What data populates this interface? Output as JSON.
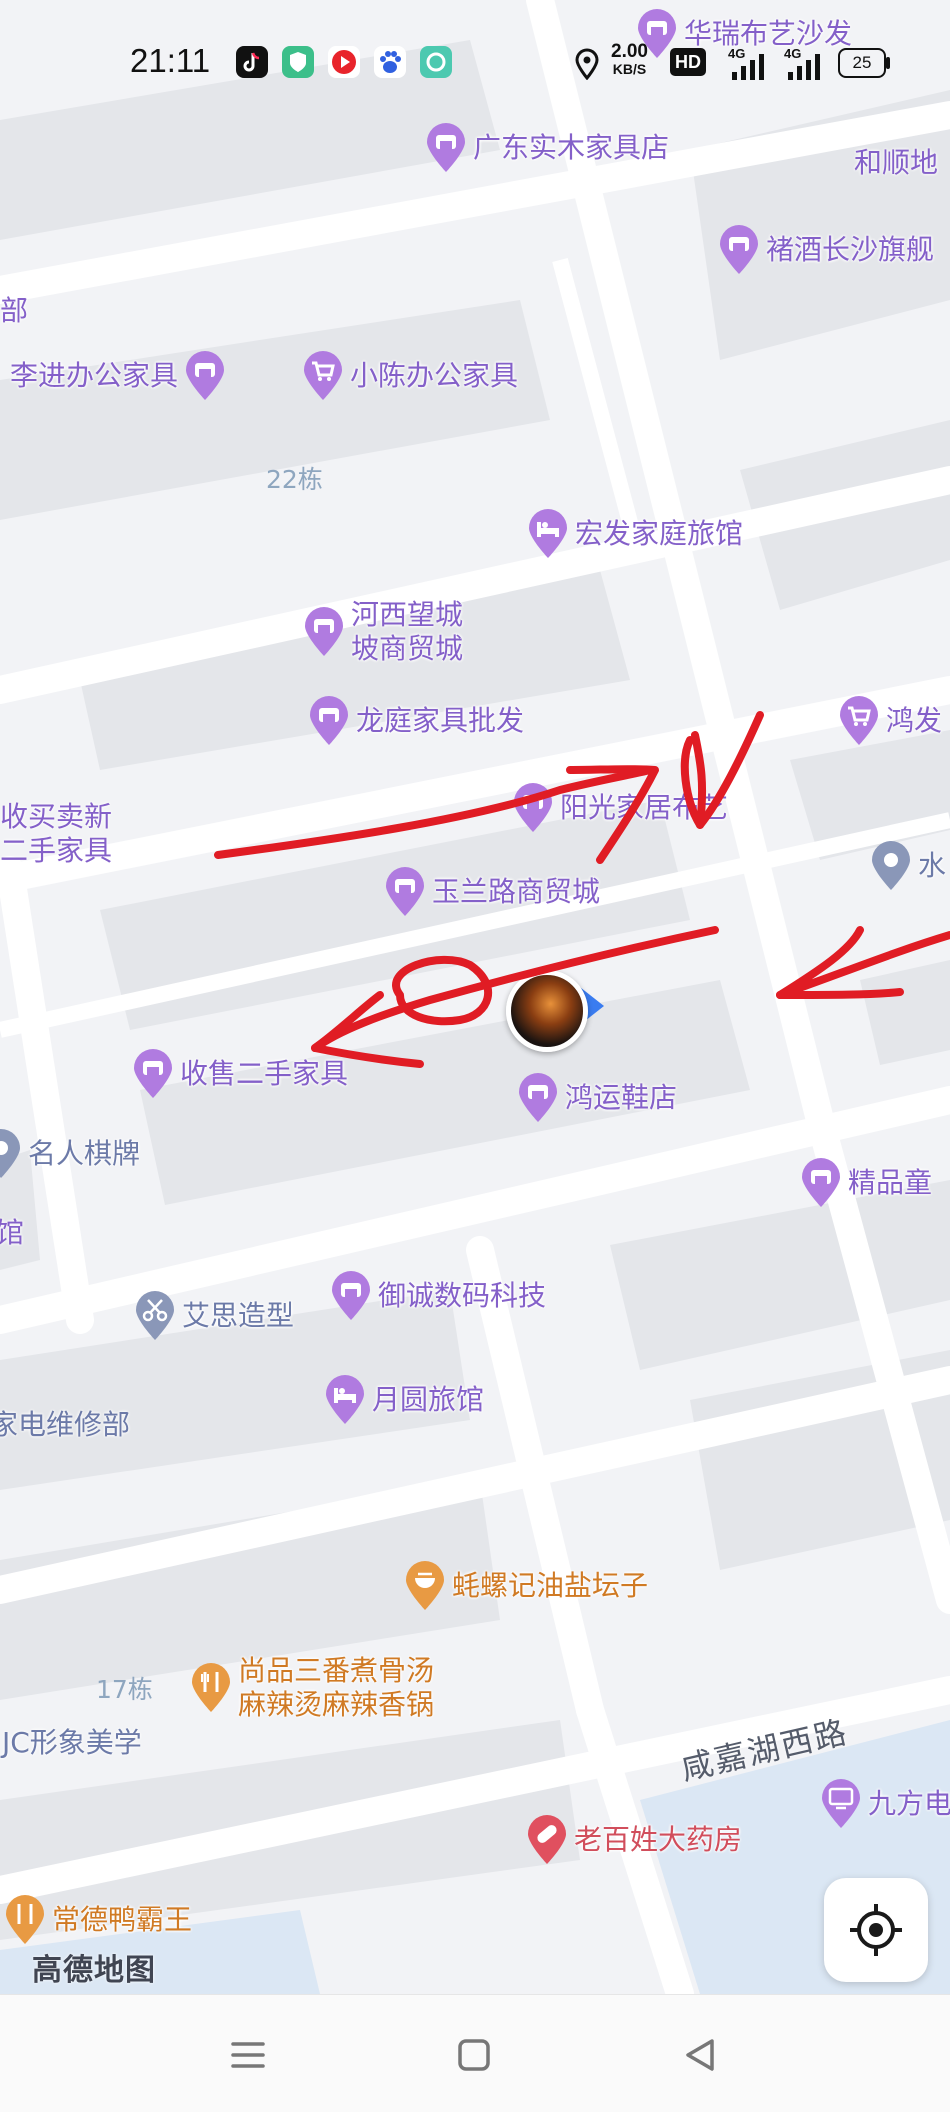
{
  "status_bar": {
    "time": "21:11",
    "net_speed": "2.00",
    "net_unit": "KB/S",
    "hd": "HD",
    "sig1": "4G",
    "sig2": "4G",
    "battery": "25"
  },
  "map": {
    "brand": "高德地图",
    "road_name": "咸嘉湖西路",
    "buildings": [
      "22栋",
      "17栋"
    ],
    "pois": [
      {
        "name": "华瑞布艺沙发",
        "icon": "shop-icon",
        "color": "purple"
      },
      {
        "name": "广东实木家具店",
        "icon": "shop-icon",
        "color": "purple"
      },
      {
        "name": "和顺地",
        "icon": "none",
        "color": "purple"
      },
      {
        "name": "褚酒长沙旗舰",
        "icon": "shop-icon",
        "color": "purple"
      },
      {
        "name": "部",
        "icon": "none",
        "color": "purple"
      },
      {
        "name": "李进办公家具",
        "icon": "shop-icon",
        "color": "purple"
      },
      {
        "name": "小陈办公家具",
        "icon": "cart-icon",
        "color": "purple"
      },
      {
        "name": "宏发家庭旅馆",
        "icon": "hotel-icon",
        "color": "purple"
      },
      {
        "name": "河西望城",
        "name2": "坡商贸城",
        "icon": "shop-icon",
        "color": "purple"
      },
      {
        "name": "龙庭家具批发",
        "icon": "shop-icon",
        "color": "purple"
      },
      {
        "name": "鸿发",
        "icon": "cart-icon",
        "color": "purple"
      },
      {
        "name": "收买卖新",
        "name2": "二手家具",
        "icon": "none",
        "color": "purple"
      },
      {
        "name": "阳光家居布艺",
        "icon": "shop-icon",
        "color": "purple"
      },
      {
        "name": "水",
        "icon": "location-icon",
        "color": "blue"
      },
      {
        "name": "玉兰路商贸城",
        "icon": "shop-icon",
        "color": "purple"
      },
      {
        "name": "收售二手家具",
        "icon": "shop-icon",
        "color": "purple"
      },
      {
        "name": "鸿运鞋店",
        "icon": "shop-icon",
        "color": "purple"
      },
      {
        "name": "名人棋牌",
        "icon": "location-icon",
        "color": "blue"
      },
      {
        "name": "精品童",
        "icon": "shop-icon",
        "color": "purple"
      },
      {
        "name": "馆",
        "icon": "none",
        "color": "purple"
      },
      {
        "name": "艾思造型",
        "icon": "scissors-icon",
        "color": "blue"
      },
      {
        "name": "御诚数码科技",
        "icon": "shop-icon",
        "color": "purple"
      },
      {
        "name": "月圆旅馆",
        "icon": "hotel-icon",
        "color": "purple"
      },
      {
        "name": "家电维修部",
        "icon": "none",
        "color": "blue"
      },
      {
        "name": "蚝螺记油盐坛子",
        "icon": "food-icon",
        "color": "orange"
      },
      {
        "name": "尚品三番煮骨汤",
        "name2": "麻辣烫麻辣香锅",
        "icon": "food-icon",
        "color": "orange"
      },
      {
        "name": "JC形象美学",
        "icon": "none",
        "color": "blue"
      },
      {
        "name": "九方电",
        "icon": "tv-icon",
        "color": "purple"
      },
      {
        "name": "老百姓大药房",
        "icon": "pharmacy-icon",
        "color": "red"
      },
      {
        "name": "常德鸭霸王",
        "icon": "food-icon",
        "color": "orange"
      }
    ]
  },
  "colors": {
    "poi_purple": "#b07be0",
    "poi_orange": "#e89a43",
    "poi_blue": "#8a97b8",
    "poi_red": "#e0505f",
    "scribble": "#e01c24",
    "location_arrow": "#3a7cf0"
  },
  "nav_bar": {
    "menu_icon": "menu-icon",
    "home_icon": "home-square-icon",
    "back_icon": "back-triangle-icon"
  }
}
